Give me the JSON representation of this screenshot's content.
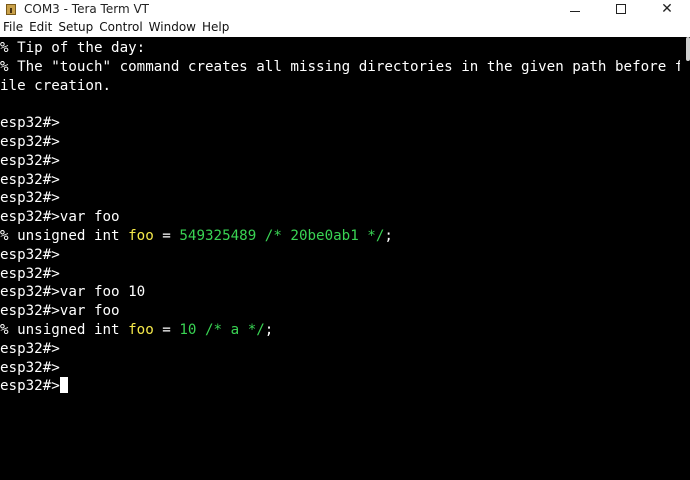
{
  "window": {
    "title": "COM3 - Tera Term VT",
    "minimize_glyph": "",
    "maximize_glyph": "",
    "close_glyph": "✕"
  },
  "menu": [
    "File",
    "Edit",
    "Setup",
    "Control",
    "Window",
    "Help"
  ],
  "terminal": {
    "lines": [
      {
        "segments": [
          {
            "text": "% Tip of the day:"
          }
        ]
      },
      {
        "segments": [
          {
            "text": "% The \"touch\" command creates all missing directories in the given path before f"
          }
        ]
      },
      {
        "segments": [
          {
            "text": "ile creation."
          }
        ]
      },
      {
        "segments": [
          {
            "text": ""
          }
        ]
      },
      {
        "segments": [
          {
            "text": "esp32#>"
          }
        ]
      },
      {
        "segments": [
          {
            "text": "esp32#>"
          }
        ]
      },
      {
        "segments": [
          {
            "text": "esp32#>"
          }
        ]
      },
      {
        "segments": [
          {
            "text": "esp32#>"
          }
        ]
      },
      {
        "segments": [
          {
            "text": "esp32#>"
          }
        ]
      },
      {
        "segments": [
          {
            "text": "esp32#>var foo"
          }
        ]
      },
      {
        "segments": [
          {
            "text": "% unsigned int "
          },
          {
            "text": "foo",
            "color": "yellow"
          },
          {
            "text": " = "
          },
          {
            "text": "549325489 /* 20be0ab1 */",
            "color": "green"
          },
          {
            "text": ";"
          }
        ]
      },
      {
        "segments": [
          {
            "text": "esp32#>"
          }
        ]
      },
      {
        "segments": [
          {
            "text": "esp32#>"
          }
        ]
      },
      {
        "segments": [
          {
            "text": "esp32#>var foo 10"
          }
        ]
      },
      {
        "segments": [
          {
            "text": "esp32#>var foo"
          }
        ]
      },
      {
        "segments": [
          {
            "text": "% unsigned int "
          },
          {
            "text": "foo",
            "color": "yellow"
          },
          {
            "text": " = "
          },
          {
            "text": "10 /* a */",
            "color": "green"
          },
          {
            "text": ";"
          }
        ]
      },
      {
        "segments": [
          {
            "text": "esp32#>"
          }
        ]
      },
      {
        "segments": [
          {
            "text": "esp32#>"
          }
        ]
      },
      {
        "segments": [
          {
            "text": "esp32#>"
          }
        ],
        "cursor": true
      }
    ]
  },
  "colors": {
    "background": "#000000",
    "text": "#ffffff",
    "yellow": "#f5e94a",
    "green": "#39d353"
  },
  "icons": {
    "app": "tera-term-tower-icon",
    "minimize": "minimize-icon",
    "maximize": "maximize-icon",
    "close": "close-icon"
  }
}
